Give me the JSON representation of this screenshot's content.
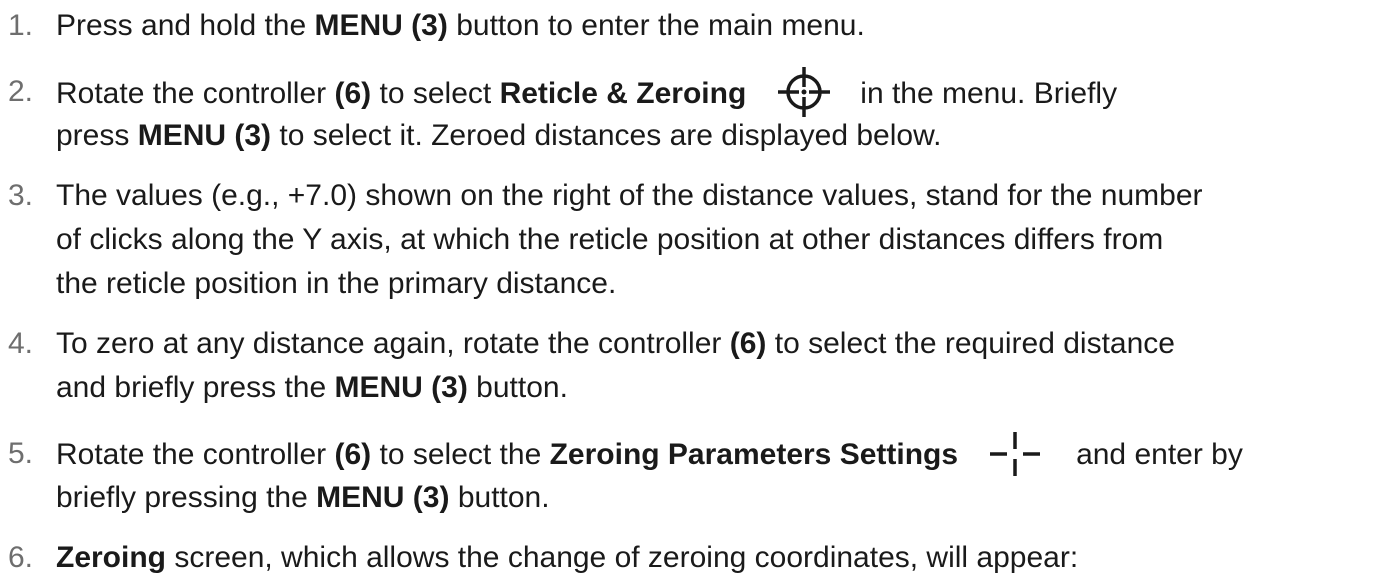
{
  "steps": [
    {
      "number": "1.",
      "lines": [
        [
          "Press and hold the ",
          "MENU (3)",
          " button to enter the main menu."
        ]
      ]
    },
    {
      "number": "2.",
      "lines": [
        [
          "Rotate the controller ",
          "(6)",
          " to select ",
          "Reticle & Zeroing",
          "in the menu. Briefly"
        ],
        [
          "press ",
          "MENU (3)",
          " to select it. Zeroed distances are displayed below."
        ]
      ],
      "icon": "crosshair-icon"
    },
    {
      "number": "3.",
      "lines": [
        [
          "The values (e.g., +7.0) shown on the right of the distance values, stand for the number"
        ],
        [
          "of clicks along the Y axis, at which the reticle position at other distances differs from"
        ],
        [
          "the reticle position in the primary distance."
        ]
      ]
    },
    {
      "number": "4.",
      "lines": [
        [
          "To zero at any distance again, rotate the controller ",
          "(6)",
          " to select the required distance"
        ],
        [
          "and briefly press the ",
          "MENU (3)",
          " button."
        ]
      ]
    },
    {
      "number": "5.",
      "lines": [
        [
          "Rotate the controller ",
          "(6)",
          " to select the ",
          "Zeroing Parameters Settings",
          "and enter by"
        ],
        [
          "briefly pressing the ",
          "MENU (3)",
          " button."
        ]
      ],
      "icon": "zeroing-parameters-icon"
    },
    {
      "number": "6.",
      "lines": [
        [
          "Zeroing",
          " screen, which allows the change of zeroing coordinates, will appear:"
        ]
      ]
    }
  ],
  "colors": {
    "text": "#1a1a1a",
    "number": "#6e6e6e"
  }
}
